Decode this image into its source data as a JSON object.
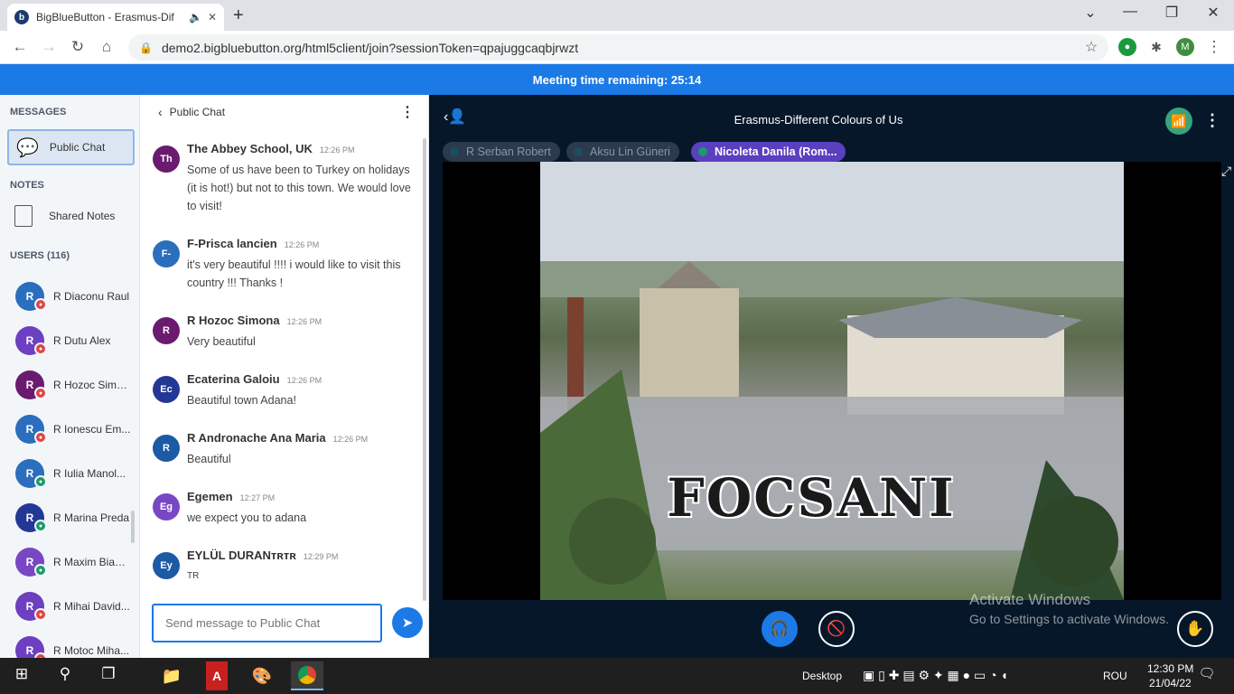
{
  "browser": {
    "tab_title": "BigBlueButton - Erasmus-Dif",
    "tab_favicon": "b",
    "url": "demo2.bigbluebutton.org/html5client/join?sessionToken=qpajuggcaqbjrwzt",
    "profile_initial": "M"
  },
  "banner": {
    "text": "Meeting time remaining: 25:14"
  },
  "sidebar": {
    "messages_title": "MESSAGES",
    "public_chat_label": "Public Chat",
    "notes_title": "NOTES",
    "shared_notes_label": "Shared Notes",
    "users_title": "USERS (116)",
    "users": [
      {
        "initial": "R",
        "name": "R Diaconu Raul",
        "color": "#2a6ebd",
        "badge_color": "#e04545"
      },
      {
        "initial": "R",
        "name": "R Dutu Alex",
        "color": "#6d3fc1",
        "badge_color": "#e04545"
      },
      {
        "initial": "R",
        "name": "R Hozoc Simo...",
        "color": "#6a1b6f",
        "badge_color": "#e04545"
      },
      {
        "initial": "R",
        "name": "R Ionescu Em...",
        "color": "#2a6ebd",
        "badge_color": "#e04545"
      },
      {
        "initial": "R",
        "name": "R Iulia Manol...",
        "color": "#2a6ebd",
        "badge_color": "#1a9a6e"
      },
      {
        "initial": "R",
        "name": "R Marina Preda",
        "color": "#233896",
        "badge_color": "#1a9a6e"
      },
      {
        "initial": "R",
        "name": "R Maxim Bianca",
        "color": "#7a47c4",
        "badge_color": "#1a9a6e"
      },
      {
        "initial": "R",
        "name": "R Mihai David...",
        "color": "#6d3fc1",
        "badge_color": "#e04545"
      },
      {
        "initial": "R",
        "name": "R Motoc Miha...",
        "color": "#6d3fc1",
        "badge_color": "#e04545"
      }
    ]
  },
  "chat": {
    "header": "Public Chat",
    "messages": [
      {
        "initials": "Th",
        "color": "#6a1b6f",
        "name": "The Abbey School, UK",
        "time": "12:26 PM",
        "text": "Some of us have been to Turkey on holidays (it is hot!) but not to this town. We would love to visit!"
      },
      {
        "initials": "F-",
        "color": "#2a6ebd",
        "name": "F-Prisca lancien",
        "time": "12:26 PM",
        "text": "it's very beautiful !!!! i would like to visit this country !!! Thanks !"
      },
      {
        "initials": "R",
        "color": "#6a1b6f",
        "name": "R Hozoc Simona",
        "time": "12:26 PM",
        "text": "Very beautiful"
      },
      {
        "initials": "Ec",
        "color": "#233896",
        "name": "Ecaterina Galoiu",
        "time": "12:26 PM",
        "text": "Beautiful town Adana!"
      },
      {
        "initials": "R",
        "color": "#1c5aa6",
        "name": "R Andronache Ana Maria",
        "time": "12:26 PM",
        "text": "Beautiful"
      },
      {
        "initials": "Eg",
        "color": "#7a47c4",
        "name": "Egemen",
        "time": "12:27 PM",
        "text": "we expect you to adana"
      },
      {
        "initials": "Ey",
        "color": "#1c5aa6",
        "name": "EYLÜL DURANᴛʀᴛʀ",
        "time": "12:29 PM",
        "text": "TR"
      }
    ],
    "input_placeholder": "Send message to Public Chat"
  },
  "main": {
    "meeting_title": "Erasmus-Different Colours of Us",
    "talkers": [
      {
        "name": "R Serban Robert",
        "bg": "#2b3a4d",
        "fg": "#8b96a3",
        "dot": "#1b4e5e"
      },
      {
        "name": "Aksu Lin Güneri",
        "bg": "#2b3a4d",
        "fg": "#8b96a3",
        "dot": "#1b4e5e"
      },
      {
        "name": "Nicoleta Danila (Rom...",
        "bg": "#5a3fbf",
        "fg": "#ffffff",
        "dot": "#1a9a6e"
      }
    ],
    "video_caption": "FOCSANI",
    "watermark_title": "Activate Windows",
    "watermark_sub": "Go to Settings to activate Windows."
  },
  "taskbar": {
    "desktop_label": "Desktop",
    "lang": "ROU",
    "time": "12:30 PM",
    "date": "21/04/22"
  }
}
